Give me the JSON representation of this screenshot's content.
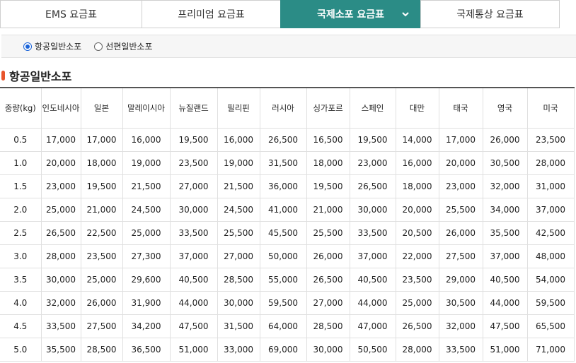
{
  "tabs": [
    {
      "label": "EMS 요금표",
      "active": false
    },
    {
      "label": "프리미엄 요금표",
      "active": false
    },
    {
      "label": "국제소포 요금표",
      "active": true
    },
    {
      "label": "국제통상 요금표",
      "active": false
    }
  ],
  "accent_color": "#2b8c86",
  "radio_options": [
    {
      "label": "항공일반소포",
      "selected": true
    },
    {
      "label": "선편일반소포",
      "selected": false
    }
  ],
  "section_title": "항공일반소포",
  "table": {
    "headers": [
      "중량(kg)",
      "인도네시아",
      "일본",
      "말레이시아",
      "뉴질랜드",
      "필리핀",
      "러시아",
      "싱가포르",
      "스페인",
      "대만",
      "태국",
      "영국",
      "미국"
    ],
    "rows": [
      [
        "0.5",
        "17,000",
        "17,000",
        "16,000",
        "19,500",
        "16,000",
        "26,500",
        "16,500",
        "19,500",
        "14,000",
        "17,000",
        "26,000",
        "23,500"
      ],
      [
        "1.0",
        "20,000",
        "18,000",
        "19,000",
        "23,500",
        "19,000",
        "31,500",
        "18,000",
        "23,000",
        "16,000",
        "20,000",
        "30,500",
        "28,000"
      ],
      [
        "1.5",
        "23,000",
        "19,500",
        "21,500",
        "27,000",
        "21,500",
        "36,000",
        "19,500",
        "26,500",
        "18,000",
        "23,000",
        "32,000",
        "31,000"
      ],
      [
        "2.0",
        "25,000",
        "21,000",
        "24,500",
        "30,000",
        "24,500",
        "41,000",
        "21,000",
        "30,000",
        "20,000",
        "25,500",
        "34,000",
        "37,000"
      ],
      [
        "2.5",
        "26,500",
        "22,500",
        "25,000",
        "33,500",
        "25,500",
        "45,500",
        "25,500",
        "33,500",
        "20,500",
        "26,000",
        "35,500",
        "42,500"
      ],
      [
        "3.0",
        "28,000",
        "23,500",
        "27,300",
        "37,000",
        "27,000",
        "50,000",
        "26,000",
        "37,000",
        "22,000",
        "27,500",
        "37,000",
        "48,000"
      ],
      [
        "3.5",
        "30,000",
        "25,000",
        "29,600",
        "40,500",
        "28,500",
        "55,000",
        "26,500",
        "40,500",
        "23,500",
        "29,000",
        "40,500",
        "54,000"
      ],
      [
        "4.0",
        "32,000",
        "26,000",
        "31,900",
        "44,000",
        "30,000",
        "59,500",
        "27,000",
        "44,000",
        "25,000",
        "30,500",
        "44,000",
        "59,500"
      ],
      [
        "4.5",
        "33,500",
        "27,500",
        "34,200",
        "47,500",
        "31,500",
        "64,000",
        "28,500",
        "47,000",
        "26,500",
        "32,000",
        "47,500",
        "65,500"
      ],
      [
        "5.0",
        "35,500",
        "28,500",
        "36,500",
        "51,000",
        "33,000",
        "69,000",
        "30,000",
        "50,500",
        "28,000",
        "33,500",
        "51,000",
        "71,000"
      ]
    ]
  }
}
